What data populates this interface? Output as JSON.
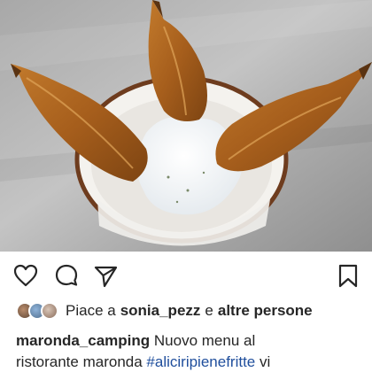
{
  "post": {
    "image_icon": "food-photo-fried-stuffed-anchovies-with-yogurt-dip"
  },
  "actions": {
    "like_icon": "heart-icon",
    "comment_icon": "comment-icon",
    "share_icon": "paper-plane-icon",
    "save_icon": "bookmark-icon"
  },
  "likes": {
    "prefix": "Piace a",
    "user": "sonia_pezz",
    "connector": "e",
    "others": "altre persone"
  },
  "caption": {
    "username": "maronda_camping",
    "line1_text": "Nuovo menu al",
    "line2_text": "ristorante maronda",
    "hashtag": "#aliciripienefritte",
    "line2_tail": "vi"
  }
}
